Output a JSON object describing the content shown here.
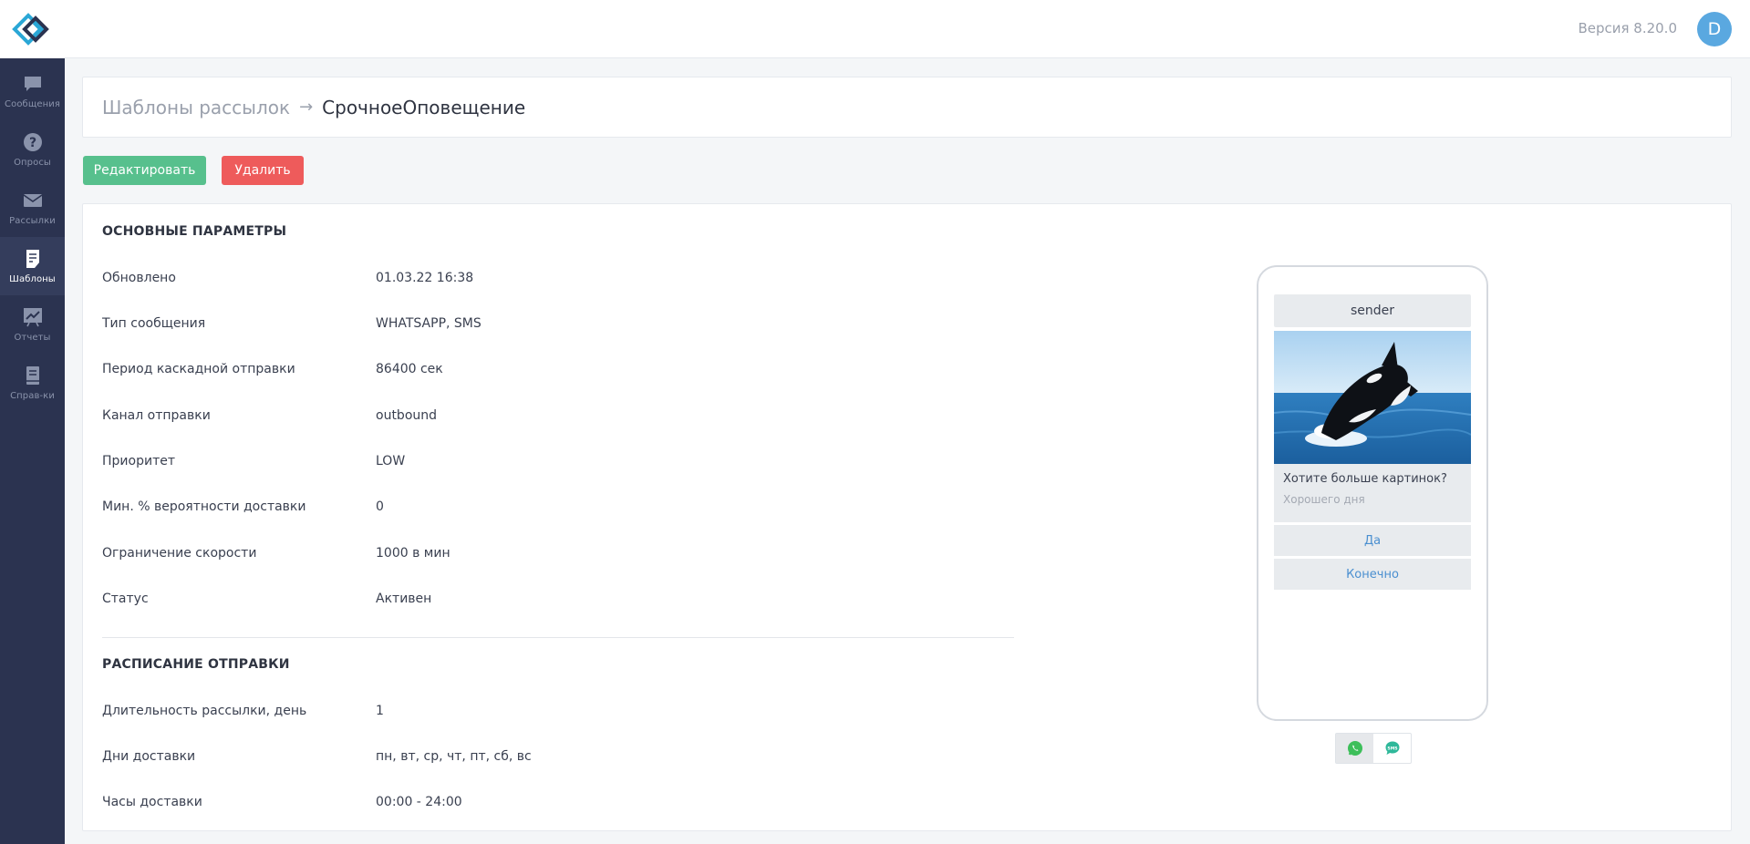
{
  "nav": [
    {
      "label": "Сообщения",
      "icon": "chat-icon"
    },
    {
      "label": "Опросы",
      "icon": "question-icon"
    },
    {
      "label": "Рассылки",
      "icon": "mail-icon"
    },
    {
      "label": "Шаблоны",
      "icon": "template-icon",
      "active": true
    },
    {
      "label": "Отчеты",
      "icon": "report-icon"
    },
    {
      "label": "Справ-ки",
      "icon": "book-icon"
    }
  ],
  "header": {
    "version": "Версия 8.20.0",
    "avatar_letter": "D"
  },
  "breadcrumb": {
    "parent": "Шаблоны рассылок",
    "arrow": "→",
    "current": "СрочноеОповещение"
  },
  "actions": {
    "edit_label": "Редактировать",
    "delete_label": "Удалить"
  },
  "main_params": {
    "title": "ОСНОВНЫЕ ПАРАМЕТРЫ",
    "rows": [
      {
        "key": "Обновлено",
        "value": "01.03.22 16:38"
      },
      {
        "key": "Тип сообщения",
        "value": "WHATSAPP, SMS"
      },
      {
        "key": "Период каскадной отправки",
        "value": "86400 сек"
      },
      {
        "key": "Канал отправки",
        "value": "outbound"
      },
      {
        "key": "Приоритет",
        "value": "LOW"
      },
      {
        "key": "Мин. % вероятности доставки",
        "value": "0"
      },
      {
        "key": "Ограничение скорости",
        "value": "1000 в мин"
      },
      {
        "key": "Статус",
        "value": "Активен"
      }
    ]
  },
  "schedule": {
    "title": "РАСПИСАНИЕ ОТПРАВКИ",
    "rows": [
      {
        "key": "Длительность рассылки, день",
        "value": "1"
      },
      {
        "key": "Дни доставки",
        "value": "пн, вт, ср, чт, пт, сб, вс"
      },
      {
        "key": "Часы доставки",
        "value": "00:00 - 24:00"
      }
    ]
  },
  "preview": {
    "sender": "sender",
    "message": "Хотите больше картинок?",
    "footer": "Хорошего дня",
    "buttons": [
      "Да",
      "Конечно"
    ],
    "channels": [
      {
        "name": "whatsapp-icon",
        "active": true
      },
      {
        "name": "sms-icon",
        "active": false
      }
    ]
  },
  "colors": {
    "sidebar": "#2b3350",
    "edit": "#57c08d",
    "delete": "#ee5b5b",
    "avatar": "#5aa8e0",
    "link": "#4a8fd0"
  }
}
